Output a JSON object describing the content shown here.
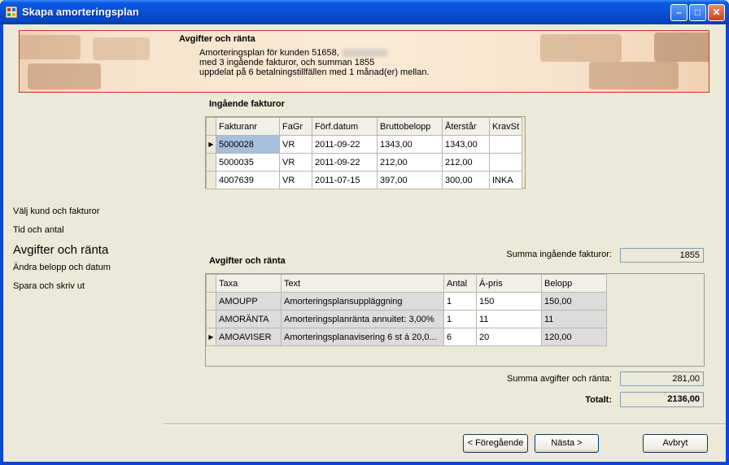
{
  "window": {
    "title": "Skapa amorteringsplan"
  },
  "banner": {
    "title": "Avgifter och ränta",
    "line1": "Amorteringsplan för kunden 51658,",
    "line2": "med 3 ingående fakturor, och summan 1855",
    "line3": "uppdelat på 6 betalningstillfällen med 1 månad(er) mellan."
  },
  "nav": {
    "items": [
      "Välj kund och fakturor",
      "Tid och antal",
      "Avgifter och ränta",
      "Ändra belopp och datum",
      "Spara och skriv ut"
    ]
  },
  "invoices": {
    "title": "Ingående fakturor",
    "columns": [
      "Fakturanr",
      "FaGr",
      "Förf.datum",
      "Bruttobelopp",
      "Återstår",
      "KravSt"
    ],
    "rows": [
      [
        "5000028",
        "VR",
        "2011-09-22",
        "1343,00",
        "1343,00",
        ""
      ],
      [
        "5000035",
        "VR",
        "2011-09-22",
        "212,00",
        "212,00",
        ""
      ],
      [
        "4007639",
        "VR",
        "2011-07-15",
        "397,00",
        "300,00",
        "INKA"
      ]
    ]
  },
  "fees": {
    "title": "Avgifter och ränta",
    "columns": [
      "Taxa",
      "Text",
      "Antal",
      "Á-pris",
      "Belopp"
    ],
    "rows": [
      [
        "AMOUPP",
        "Amorteringsplansuppläggning",
        "1",
        "150",
        "150,00"
      ],
      [
        "AMORÄNTA",
        "Amorteringsplanränta annuitet: 3,00%",
        "1",
        "11",
        "11"
      ],
      [
        "AMOAVISER",
        "Amorteringsplanavisering 6 st á 20,0...",
        "6",
        "20",
        "120,00"
      ]
    ]
  },
  "totals": {
    "invoices_label": "Summa ingående fakturor:",
    "invoices_value": "1855",
    "fees_label": "Summa avgifter och ränta:",
    "fees_value": "281,00",
    "total_label": "Totalt:",
    "total_value": "2136,00"
  },
  "buttons": {
    "prev": "< Föregående",
    "next": "Nästa >",
    "cancel": "Avbryt"
  },
  "colors": {
    "titlebar": "#0a4fd6",
    "banner_border": "#c9372b",
    "selection": "#a8bede"
  }
}
